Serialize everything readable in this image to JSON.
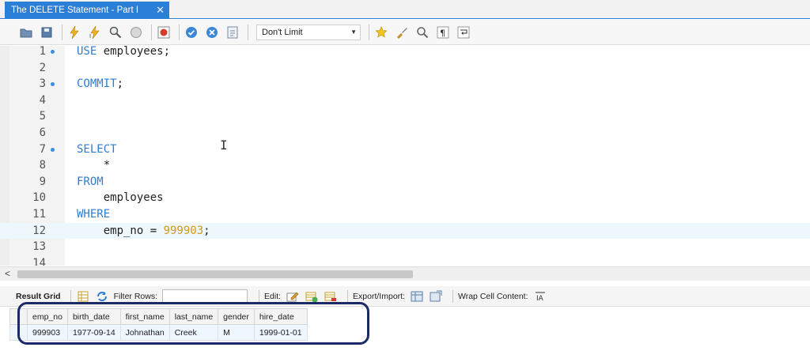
{
  "tab": {
    "title": "The DELETE Statement - Part I",
    "close": "✕"
  },
  "toolbar": {
    "limit_value": "Don't Limit"
  },
  "editor": {
    "lines": [
      {
        "n": "1",
        "dot": true,
        "parts": [
          [
            "kw",
            "USE"
          ],
          [
            "",
            " employees;"
          ]
        ]
      },
      {
        "n": "2",
        "dot": false,
        "parts": []
      },
      {
        "n": "3",
        "dot": true,
        "parts": [
          [
            "kw",
            "COMMIT"
          ],
          [
            "",
            ";"
          ]
        ]
      },
      {
        "n": "4",
        "dot": false,
        "parts": []
      },
      {
        "n": "5",
        "dot": false,
        "parts": []
      },
      {
        "n": "6",
        "dot": false,
        "parts": []
      },
      {
        "n": "7",
        "dot": true,
        "parts": [
          [
            "kw",
            "SELECT"
          ]
        ]
      },
      {
        "n": "8",
        "dot": false,
        "parts": [
          [
            "",
            "    *"
          ]
        ]
      },
      {
        "n": "9",
        "dot": false,
        "parts": [
          [
            "kw",
            "FROM"
          ]
        ]
      },
      {
        "n": "10",
        "dot": false,
        "parts": [
          [
            "",
            "    employees"
          ]
        ]
      },
      {
        "n": "11",
        "dot": false,
        "parts": [
          [
            "kw",
            "WHERE"
          ]
        ]
      },
      {
        "n": "12",
        "dot": false,
        "active": true,
        "parts": [
          [
            "",
            "    emp_no = "
          ],
          [
            "num",
            "999903"
          ],
          [
            "",
            ";"
          ]
        ]
      },
      {
        "n": "13",
        "dot": false,
        "parts": []
      },
      {
        "n": "14",
        "dot": false,
        "parts": []
      }
    ]
  },
  "result_toolbar": {
    "result_grid": "Result Grid",
    "filter_rows": "Filter Rows:",
    "edit": "Edit:",
    "export_import": "Export/Import:",
    "wrap_cell": "Wrap Cell Content:"
  },
  "grid": {
    "columns": [
      "emp_no",
      "birth_date",
      "first_name",
      "last_name",
      "gender",
      "hire_date"
    ],
    "rows": [
      [
        "999903",
        "1977-09-14",
        "Johnathan",
        "Creek",
        "M",
        "1999-01-01"
      ]
    ]
  },
  "colors": {
    "accent": "#2b7fd6",
    "keyword": "#2e7dd1",
    "number": "#d19a1a",
    "highlight": "#1a2b66"
  }
}
